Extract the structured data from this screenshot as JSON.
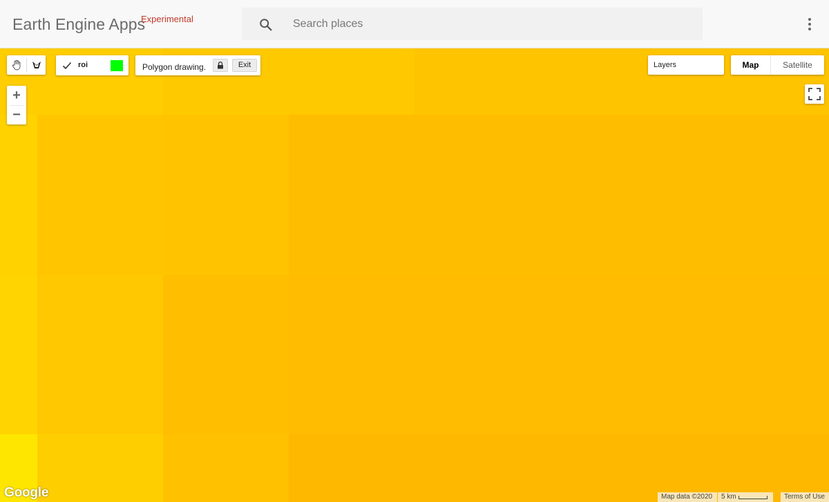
{
  "header": {
    "title": "Earth Engine Apps",
    "tag": "Experimental",
    "search_placeholder": "Search places",
    "more_icon": "more-vert-icon"
  },
  "toolbar": {
    "pan_icon": "hand-icon",
    "draw_icon": "polygon-draw-icon"
  },
  "layer": {
    "name": "roi",
    "checked": true,
    "color": "#00ff00"
  },
  "polygon": {
    "text": "Polygon drawing.",
    "lock_icon": "lock-icon",
    "exit_label": "Exit"
  },
  "zoom": {
    "in_label": "+",
    "out_label": "−"
  },
  "layers": {
    "label": "Layers"
  },
  "maptype": {
    "map_label": "Map",
    "satellite_label": "Satellite",
    "selected": "Map"
  },
  "attribution": {
    "logo": "Google",
    "map_data": "Map data ©2020",
    "scale": "5 km",
    "terms": "Terms of Use"
  },
  "colors": {
    "map_yellow_light": "#ffe600",
    "map_yellow": "#ffd000",
    "map_orange": "#ffbf00"
  }
}
